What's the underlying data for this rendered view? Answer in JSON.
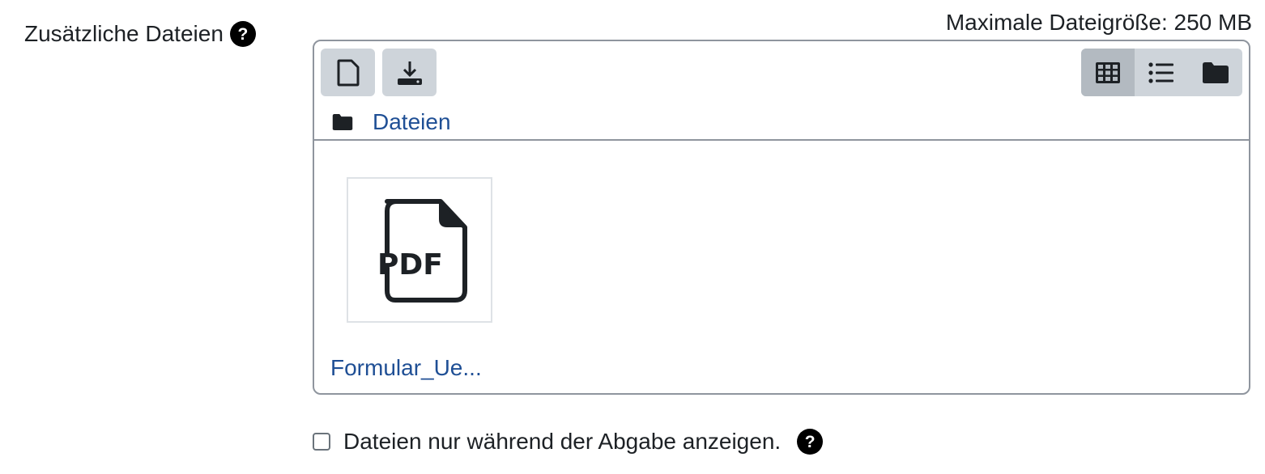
{
  "field": {
    "label": "Zusätzliche Dateien",
    "help_icon_glyph": "?"
  },
  "filemanager": {
    "max_size_text": "Maximale Dateigröße: 250 MB",
    "toolbar": {
      "add_icon": "file-icon",
      "download_icon": "download-icon",
      "views": [
        {
          "icon": "grid-icon",
          "active": true
        },
        {
          "icon": "list-icon",
          "active": false
        },
        {
          "icon": "folder-icon",
          "active": false
        }
      ]
    },
    "path": {
      "folder_icon": "folder-icon",
      "label": "Dateien"
    },
    "files": [
      {
        "name": "Formular_Ue...",
        "type_label": "PDF",
        "icon": "pdf-file-icon"
      }
    ]
  },
  "option": {
    "checkbox_label": "Dateien nur während der Abgabe anzeigen.",
    "checked": false,
    "help_icon_glyph": "?"
  },
  "colors": {
    "link": "#1f4f95",
    "toolbar_bg": "#ced4da",
    "toolbar_active_bg": "#b3bac1",
    "border": "#8f959e"
  }
}
